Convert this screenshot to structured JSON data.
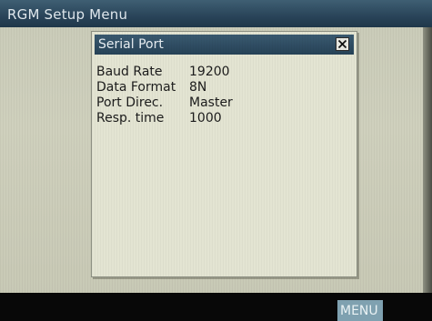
{
  "app": {
    "title": "RGM Setup Menu"
  },
  "dialog": {
    "title": "Serial Port",
    "close_icon": "close-icon",
    "rows": [
      {
        "label": "Baud Rate",
        "value": "19200"
      },
      {
        "label": "Data Format",
        "value": "8N"
      },
      {
        "label": "Port Direc.",
        "value": "Master"
      },
      {
        "label": "Resp. time",
        "value": "1000"
      }
    ]
  },
  "footer": {
    "menu_label": "MENU"
  },
  "colors": {
    "titlebar": "#294459",
    "screen_bg": "#cfd0bd",
    "menu_button": "#7fa1b0"
  }
}
